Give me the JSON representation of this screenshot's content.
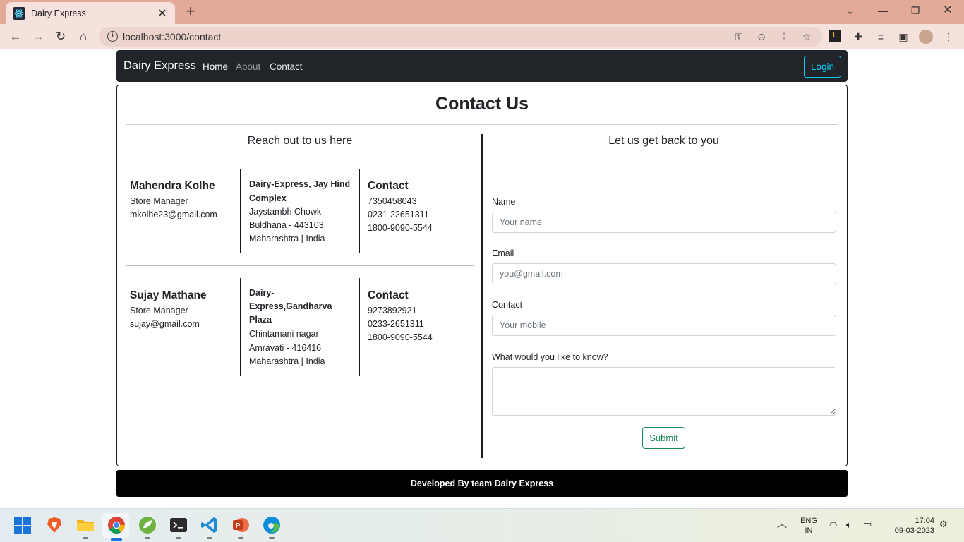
{
  "browser": {
    "tab_title": "Dairy Express",
    "url": "localhost:3000/contact"
  },
  "navbar": {
    "brand": "Dairy Express",
    "links": [
      "Home",
      "About",
      "Contact"
    ],
    "login_label": "Login"
  },
  "page": {
    "title": "Contact Us",
    "left_heading": "Reach out to us here",
    "right_heading": "Let us get back to you"
  },
  "contacts": [
    {
      "name": "Mahendra Kolhe",
      "role": "Store Manager",
      "email": "mkolhe23@gmail.com",
      "address_title_lines": [
        "Dairy-Express, Jay Hind",
        "Complex"
      ],
      "address_lines": [
        "Jaystambh Chowk",
        "Buldhana - 443103",
        "Maharashtra | India"
      ],
      "contact_heading": "Contact",
      "phones": [
        "7350458043",
        "0231-22651311",
        "1800-9090-5544"
      ]
    },
    {
      "name": "Sujay Mathane",
      "role": "Store Manager",
      "email": "sujay@gmail.com",
      "address_title_lines": [
        "Dairy-",
        "Express,Gandharva",
        "Plaza"
      ],
      "address_lines": [
        "Chintamani nagar",
        "Amravati - 416416",
        "Maharashtra | India"
      ],
      "contact_heading": "Contact",
      "phones": [
        "9273892921",
        "0233-2651311",
        "1800-9090-5544"
      ]
    }
  ],
  "form": {
    "name_label": "Name",
    "name_placeholder": "Your name",
    "email_label": "Email",
    "email_placeholder": "you@gmail.com",
    "contact_label": "Contact",
    "contact_placeholder": "Your mobile",
    "question_label": "What would you like to know?",
    "submit_label": "Submit"
  },
  "footer": {
    "text": "Developed By team Dairy Express"
  },
  "taskbar": {
    "lang_top": "ENG",
    "lang_bottom": "IN",
    "time": "17:04",
    "date": "09-03-2023"
  },
  "colors": {
    "navbar_bg": "#212529",
    "login_accent": "#0dcaf0",
    "submit_accent": "#198754",
    "footer_bg": "#000000",
    "browser_frame": "#e3aa98"
  }
}
